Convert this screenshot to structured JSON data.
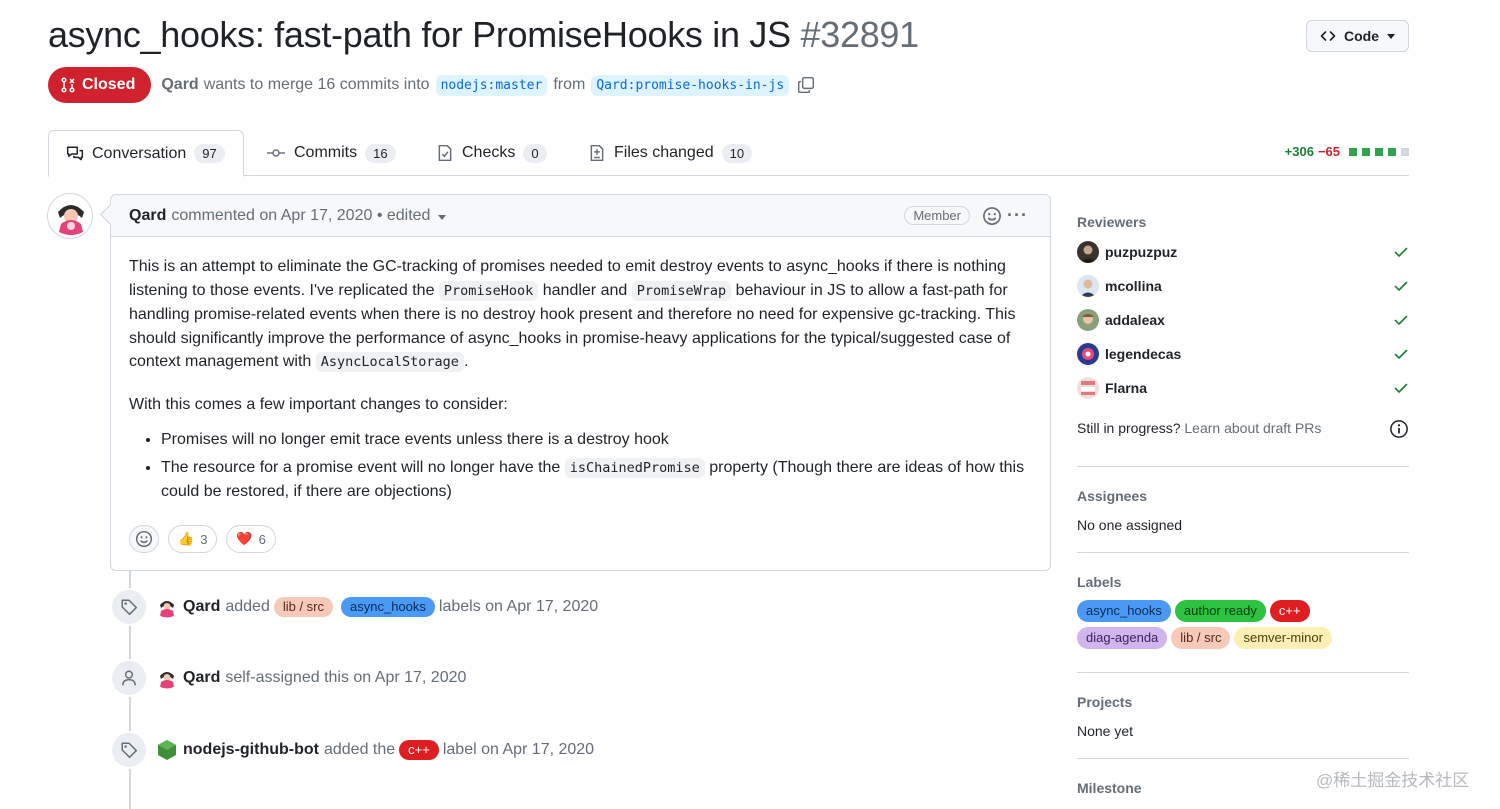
{
  "pr": {
    "title": "async_hooks: fast-path for PromiseHooks in JS",
    "number": "#32891",
    "state": "Closed",
    "author": "Qard",
    "merge_text": "wants to merge 16 commits into",
    "base_branch": "nodejs:master",
    "from_text": "from",
    "head_branch": "Qard:promise-hooks-in-js"
  },
  "code_button": "Code",
  "tabs": [
    {
      "label": "Conversation",
      "count": "97"
    },
    {
      "label": "Commits",
      "count": "16"
    },
    {
      "label": "Checks",
      "count": "0"
    },
    {
      "label": "Files changed",
      "count": "10"
    }
  ],
  "diffstat": {
    "additions": "+306",
    "deletions": "−65"
  },
  "comment": {
    "author": "Qard",
    "meta": "commented on Apr 17, 2020 • edited",
    "role": "Member",
    "p1_a": "This is an attempt to eliminate the GC-tracking of promises needed to emit destroy events to async_hooks if there is nothing listening to those events. I've replicated the ",
    "p1_code1": "PromiseHook",
    "p1_b": " handler and ",
    "p1_code2": "PromiseWrap",
    "p1_c": " behaviour in JS to allow a fast-path for handling promise-related events when there is no destroy hook present and therefore no need for expensive gc-tracking. This should significantly improve the performance of async_hooks in promise-heavy applications for the typical/suggested case of context management with ",
    "p1_code3": "AsyncLocalStorage",
    "p1_d": ".",
    "p2": "With this comes a few important changes to consider:",
    "li1": "Promises will no longer emit trace events unless there is a destroy hook",
    "li2_a": "The resource for a promise event will no longer have the ",
    "li2_code": "isChainedPromise",
    "li2_b": " property (Though there are ideas of how this could be restored, if there are objections)",
    "reactions": [
      {
        "emoji": "👍",
        "count": "3"
      },
      {
        "emoji": "❤️",
        "count": "6"
      }
    ]
  },
  "timeline": [
    {
      "actor": "Qard",
      "pre": "added",
      "labels": [
        "lib / src",
        "async_hooks"
      ],
      "post": "labels on Apr 17, 2020"
    },
    {
      "actor": "Qard",
      "pre": "self-assigned this on Apr 17, 2020"
    },
    {
      "actor": "nodejs-github-bot",
      "pre": "added the",
      "labels": [
        "c++"
      ],
      "post": "label on Apr 17, 2020"
    }
  ],
  "sidebar": {
    "reviewers_title": "Reviewers",
    "reviewers": [
      "puzpuzpuz",
      "mcollina",
      "addaleax",
      "legendecas",
      "Flarna"
    ],
    "draft_text": "Still in progress?",
    "draft_link": "Learn about draft PRs",
    "assignees_title": "Assignees",
    "assignees_value": "No one assigned",
    "labels_title": "Labels",
    "labels": [
      "async_hooks",
      "author ready",
      "c++",
      "diag-agenda",
      "lib / src",
      "semver-minor"
    ],
    "projects_title": "Projects",
    "projects_value": "None yet",
    "milestone_title": "Milestone"
  },
  "label_colors": {
    "async_hooks": "#4a9af5",
    "author ready": "#2bc33f",
    "c++": "#e01e22",
    "diag-agenda": "#d1b5ee",
    "lib / src": "#f6c9b8",
    "semver-minor": "#fbf0b3"
  },
  "watermark": "@稀土掘金技术社区"
}
